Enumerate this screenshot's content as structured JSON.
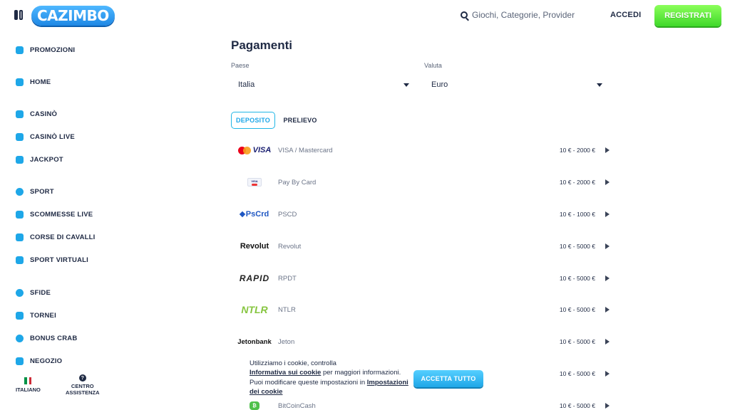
{
  "header": {
    "logo_text": "CAZIMBO",
    "search_placeholder": "Giochi, Categorie, Provider",
    "login_label": "ACCEDI",
    "register_label": "REGISTRATI"
  },
  "sidebar": {
    "items": [
      {
        "label": "PROMOZIONI",
        "icon": "gift-icon"
      },
      {
        "label": "HOME",
        "icon": "home-icon"
      },
      {
        "label": "CASINÒ",
        "icon": "slot-machine-icon"
      },
      {
        "label": "CASINÒ LIVE",
        "icon": "live-dealer-icon"
      },
      {
        "label": "JACKPOT",
        "icon": "jackpot-icon"
      },
      {
        "label": "SPORT",
        "icon": "ball-icon"
      },
      {
        "label": "SCOMMESSE LIVE",
        "icon": "live-bet-icon"
      },
      {
        "label": "CORSE DI CAVALLI",
        "icon": "horse-icon"
      },
      {
        "label": "SPORT VIRTUALI",
        "icon": "gamepad-icon"
      },
      {
        "label": "SFIDE",
        "icon": "medal-icon"
      },
      {
        "label": "TORNEI",
        "icon": "trophy-icon"
      },
      {
        "label": "BONUS CRAB",
        "icon": "crab-icon"
      },
      {
        "label": "NEGOZIO",
        "icon": "shop-icon"
      }
    ],
    "footer": {
      "language_label": "ITALIANO",
      "help_label_line1": "CENTRO",
      "help_label_line2": "ASSISTENZA",
      "help_glyph": "?"
    }
  },
  "main": {
    "title": "Pagamenti",
    "country_label": "Paese",
    "country_value": "Italia",
    "currency_label": "Valuta",
    "currency_value": "Euro",
    "tabs": [
      {
        "label": "DEPOSITO",
        "active": true
      },
      {
        "label": "PRELIEVO",
        "active": false
      }
    ],
    "methods": [
      {
        "logo": "VISA",
        "name": "VISA / Mastercard",
        "limit": "10 € - 2000 €"
      },
      {
        "logo": "VISA",
        "name": "Pay By Card",
        "limit": "10 € - 2000 €"
      },
      {
        "logo": "PsCrd",
        "name": "PSCD",
        "limit": "10 € - 1000 €"
      },
      {
        "logo": "Revolut",
        "name": "Revolut",
        "limit": "10 € - 5000 €"
      },
      {
        "logo": "RAPID",
        "name": "RPDT",
        "limit": "10 € - 5000 €"
      },
      {
        "logo": "NTLR",
        "name": "NTLR",
        "limit": "10 € - 5000 €"
      },
      {
        "logo": "Jetonbank",
        "name": "Jeton",
        "limit": "10 € - 5000 €"
      },
      {
        "logo": "",
        "name": "",
        "limit": "10 € - 5000 €"
      },
      {
        "logo": "₿",
        "name": "BitCoinCash",
        "limit": "10 € - 5000 €"
      }
    ]
  },
  "cookie": {
    "line1": "Utilizziamo i cookie, controlla",
    "link1": "Informativa sui cookie",
    "line2": " per maggiori informazioni. Puoi modificare queste impostazioni in ",
    "link2": "Impostazioni dei cookie",
    "accept_label": "ACCETTA TUTTO"
  },
  "colors": {
    "accent": "#1ea7e8",
    "register": "#4fe534",
    "text": "#1f2a44"
  }
}
